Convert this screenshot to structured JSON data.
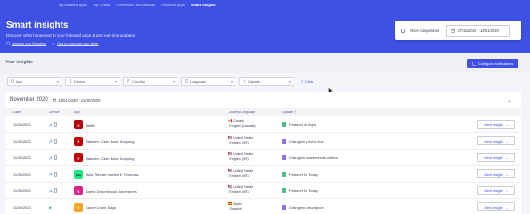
{
  "nav": {
    "items": [
      "My followed apps",
      "Top Charts",
      "Conversion Benchmarks",
      "Featured Apps",
      "Smart Insights"
    ],
    "active": "Smart Insights"
  },
  "hero": {
    "title": "Smart insights",
    "subtitle": "Discover what happened to your followed apps & get real-time updates",
    "links": [
      "Navigate your Newsfeed",
      "How to customize your alerts"
    ]
  },
  "hero_filters": {
    "show_competitors_label": "Show competitors",
    "date_range": "07/15/2020 - 12/01/2020"
  },
  "insights": {
    "title": "Your insights",
    "configure_label": "Configure notifications"
  },
  "filters": {
    "app": "App",
    "device": "Device",
    "country": "Country",
    "language": "Language",
    "update": "Update",
    "clear": "Clear"
  },
  "section": {
    "month": "November 2020",
    "range": "11/01/2020 - 11/30/2020"
  },
  "table": {
    "headers": {
      "date": "Date",
      "device": "Device",
      "app": "App",
      "country": "Country/Language",
      "update": "Update"
    },
    "rows": [
      {
        "date": "11/30/2020",
        "app": "Netflix",
        "country_l1": "Canada",
        "country_l2": "- English (Canada)",
        "update": "Featured in Apps",
        "view": "View insight"
      },
      {
        "date": "11/30/2020",
        "app": "Rakuten: Cash Back Shopping",
        "country_l1": "United States",
        "country_l2": "- English (US)",
        "update": "Change in promo text",
        "view": "View insight"
      },
      {
        "date": "11/30/2020",
        "app": "Rakuten: Cash Back Shopping",
        "country_l1": "United States",
        "country_l2": "- English (US)",
        "update": "Change in screenshots, videos",
        "view": "View insight"
      },
      {
        "date": "11/30/2020",
        "app": "Hulu: Stream movies & TV shows",
        "country_l1": "United States",
        "country_l2": "- English (US)",
        "update": "Featured in Today",
        "view": "View insight"
      },
      {
        "date": "11/30/2020",
        "app": "Barbie Dreamhouse Adventures",
        "country_l1": "United States",
        "country_l2": "- English (US)",
        "update": "Featured in Today",
        "view": "View insight"
      },
      {
        "date": "11/30/2020",
        "app": "Candy Crush Saga",
        "country_l1": "Spain",
        "country_l2": "- Spanish",
        "update": "Change in description",
        "view": "View insight"
      }
    ]
  },
  "colors": {
    "brand": "#3f51e4",
    "netflix": "#b20710",
    "rakuten": "#bf0000",
    "hulu": "#1ce783",
    "barbie": "#e0218a",
    "candy": "#f6a623"
  }
}
